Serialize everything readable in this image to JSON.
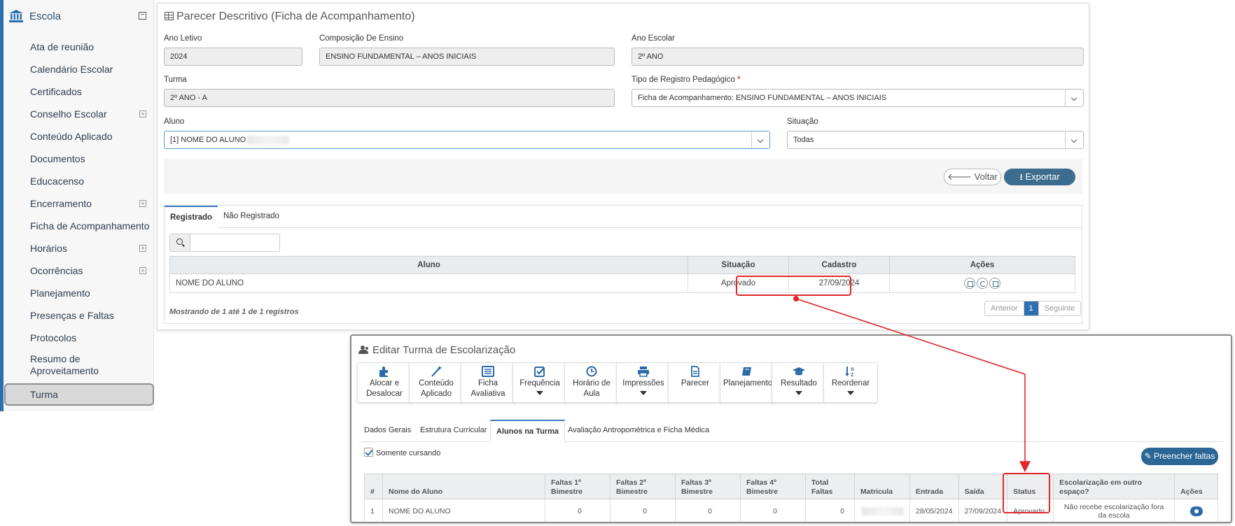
{
  "sidebar": {
    "title": "Escola",
    "items": [
      {
        "label": "Ata de reunião",
        "expandable": false
      },
      {
        "label": "Calendário Escolar",
        "expandable": false
      },
      {
        "label": "Certificados",
        "expandable": false
      },
      {
        "label": "Conselho Escolar",
        "expandable": true
      },
      {
        "label": "Conteúdo Aplicado",
        "expandable": false
      },
      {
        "label": "Documentos",
        "expandable": false
      },
      {
        "label": "Educacenso",
        "expandable": false
      },
      {
        "label": "Encerramento",
        "expandable": true
      },
      {
        "label": "Ficha de Acompanhamento",
        "expandable": false
      },
      {
        "label": "Horários",
        "expandable": true
      },
      {
        "label": "Ocorrências",
        "expandable": true
      },
      {
        "label": "Planejamento",
        "expandable": false
      },
      {
        "label": "Presenças e Faltas",
        "expandable": false
      },
      {
        "label": "Protocolos",
        "expandable": false
      },
      {
        "label": "Resumo de Aproveitamento",
        "expandable": false
      },
      {
        "label": "Turma",
        "expandable": false,
        "active": true
      }
    ]
  },
  "parecer": {
    "title": "Parecer Descritivo (Ficha de Acompanhamento)",
    "ano_letivo_label": "Ano Letivo",
    "ano_letivo": "2024",
    "composicao_label": "Composição De Ensino",
    "composicao": "ENSINO FUNDAMENTAL – ANOS INICIAIS",
    "ano_escolar_label": "Ano Escolar",
    "ano_escolar": "2º ANO",
    "turma_label": "Turma",
    "turma": "2º ANO - A",
    "tipo_label": "Tipo de Registro Pedagógico",
    "tipo": "Ficha de Acompanhamento: ENSINO FUNDAMENTAL – ANOS INICIAIS",
    "aluno_label": "Aluno",
    "aluno": "[1] NOME DO ALUNO",
    "situacao_label": "Situação",
    "situacao": "Todas",
    "voltar": "Voltar",
    "exportar": "Exportar",
    "tabs": [
      "Registrado",
      "Não Registrado"
    ],
    "table": {
      "headers": [
        "Aluno",
        "Situação",
        "Cadastro",
        "Ações"
      ],
      "rows": [
        {
          "aluno": "NOME DO ALUNO",
          "situacao": "Aprovado",
          "cadastro": "27/09/2024"
        }
      ]
    },
    "showing": "Mostrando de 1 até 1 de 1 registros",
    "pager": {
      "prev": "Anterior",
      "current": "1",
      "next": "Seguinte"
    }
  },
  "turma": {
    "title": "Editar Turma de Escolarização",
    "toolbar": [
      {
        "label": "Alocar e Desalocar",
        "icon": "puzzle-icon",
        "dropdown": false
      },
      {
        "label": "Conteúdo Aplicado",
        "icon": "magic-wand-icon",
        "dropdown": false
      },
      {
        "label": "Ficha Avaliativa",
        "icon": "list-alt-icon",
        "dropdown": false
      },
      {
        "label": "Frequência",
        "icon": "check-square-icon",
        "dropdown": true
      },
      {
        "label": "Horário de Aula",
        "icon": "clock-icon",
        "dropdown": false
      },
      {
        "label": "Impressões",
        "icon": "printer-icon",
        "dropdown": true
      },
      {
        "label": "Parecer",
        "icon": "document-icon",
        "dropdown": false
      },
      {
        "label": "Planejamento",
        "icon": "book-icon",
        "dropdown": false
      },
      {
        "label": "Resultado",
        "icon": "graduation-cap-icon",
        "dropdown": true
      },
      {
        "label": "Reordenar",
        "icon": "sort-alpha-icon",
        "dropdown": true
      }
    ],
    "tabs": [
      "Dados Gerais",
      "Estrutura Curricular",
      "Alunos na Turma",
      "Avaliação Antropométrica e Ficha Médica"
    ],
    "somente_cursando": "Somente cursando",
    "preencher_faltas": "Preencher faltas",
    "table": {
      "headers": [
        "#",
        "Nome do Aluno",
        "Faltas 1º Bimestre",
        "Faltas 2º Bimestre",
        "Faltas 3º Bimestre",
        "Faltas 4º Bimestre",
        "Total Faltas",
        "Matricula",
        "Entrada",
        "Saída",
        "Status",
        "Escolarização em outro espaço?",
        "Ações"
      ],
      "rows": [
        {
          "num": "1",
          "nome": "NOME DO ALUNO",
          "f1": "0",
          "f2": "0",
          "f3": "0",
          "f4": "0",
          "total": "0",
          "matricula": "",
          "entrada": "28/05/2024",
          "saida": "27/09/2024",
          "status": "Aprovado",
          "escolarizacao": "Não recebe escolarização fora da escola"
        }
      ]
    }
  },
  "colors": {
    "accent": "#2a6fb0",
    "highlight": "#e0282b",
    "primary_button": "#3d6d8e"
  }
}
